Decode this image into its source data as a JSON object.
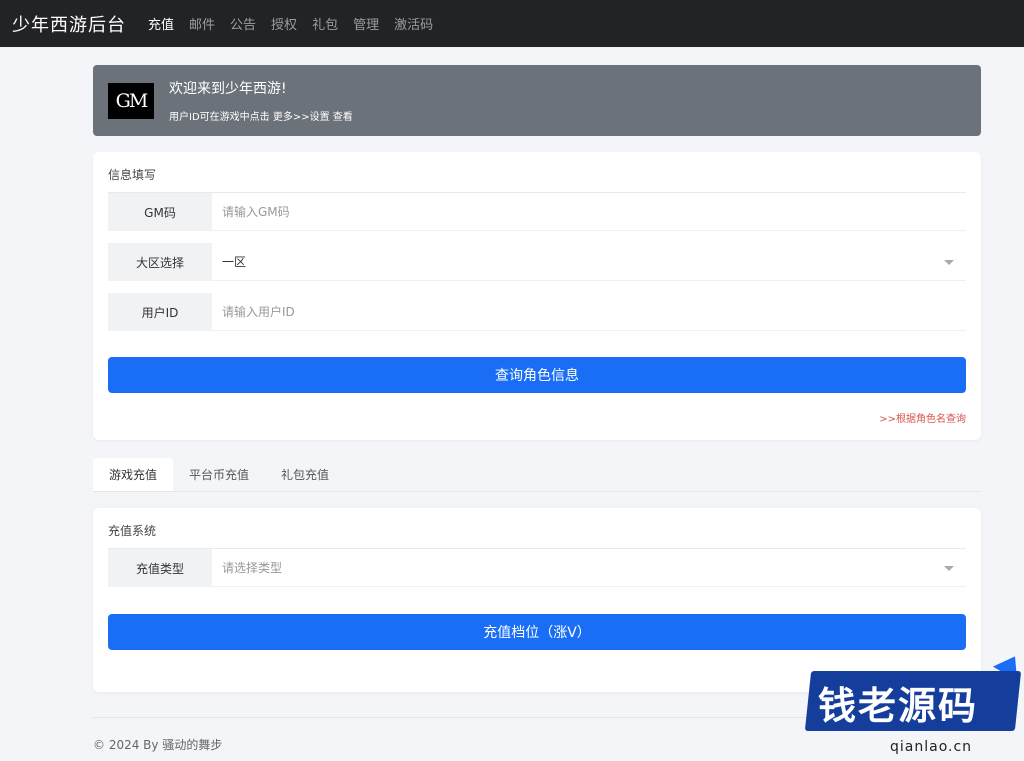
{
  "nav": {
    "brand": "少年西游后台",
    "items": [
      "充值",
      "邮件",
      "公告",
      "授权",
      "礼包",
      "管理",
      "激活码"
    ],
    "active_index": 0
  },
  "welcome": {
    "logo_text": "GM",
    "title": "欢迎来到少年西游!",
    "subtitle": "用户ID可在游戏中点击 更多>>设置 查看"
  },
  "info_form": {
    "title": "信息填写",
    "gm_code": {
      "label": "GM码",
      "placeholder": "请输入GM码"
    },
    "region": {
      "label": "大区选择",
      "value": "一区"
    },
    "user_id": {
      "label": "用户ID",
      "placeholder": "请输入用户ID"
    },
    "query_button": "查询角色信息",
    "role_link": ">>根据角色名查询"
  },
  "tabs": [
    "游戏充值",
    "平台币充值",
    "礼包充值"
  ],
  "recharge": {
    "title": "充值系统",
    "type": {
      "label": "充值类型",
      "placeholder": "请选择类型"
    },
    "button": "充值档位（涨V）"
  },
  "footer": {
    "text": "© 2024 By 骚动的舞步"
  },
  "watermark": {
    "text": "钱老源码",
    "url": "qianlao.cn"
  },
  "colors": {
    "primary": "#1a6ef5",
    "navbar": "#222325",
    "welcome_bg": "#6c727a",
    "link_red": "#d9534f"
  }
}
